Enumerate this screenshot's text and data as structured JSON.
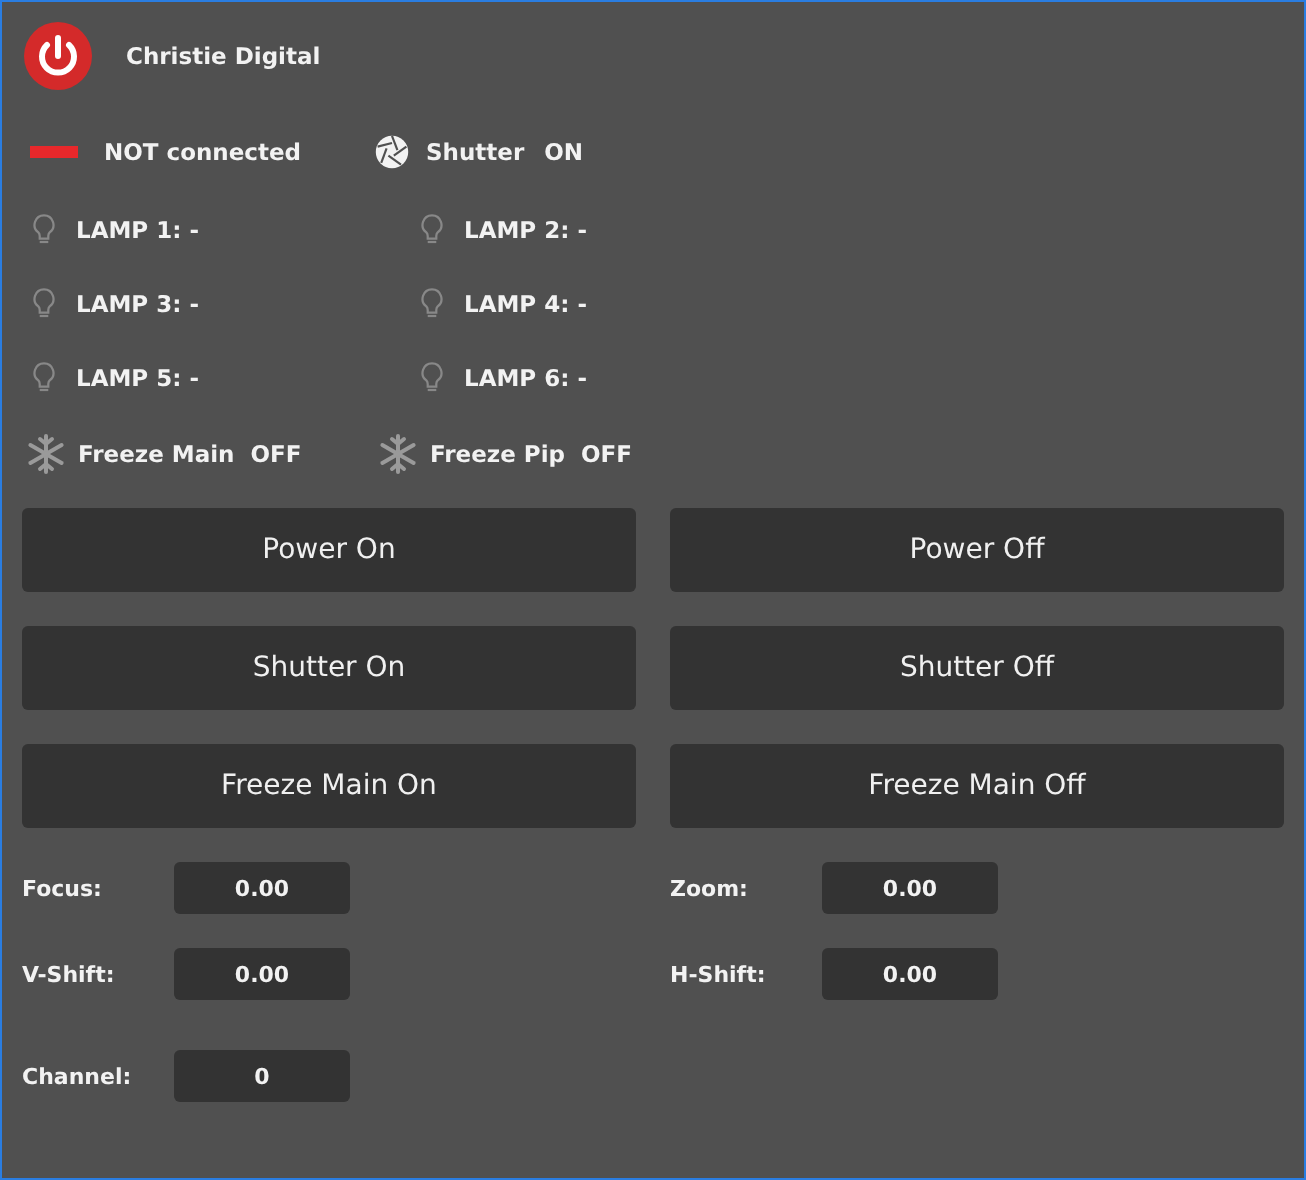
{
  "device": {
    "name": "Christie Digital",
    "powered": true
  },
  "connection": {
    "connected": false,
    "label": "NOT connected"
  },
  "shutter": {
    "label": "Shutter",
    "state": "ON",
    "on": true
  },
  "lamps": [
    {
      "label": "LAMP 1: -",
      "lit": false
    },
    {
      "label": "LAMP 2: -",
      "lit": false
    },
    {
      "label": "LAMP 3: -",
      "lit": false
    },
    {
      "label": "LAMP 4: -",
      "lit": false
    },
    {
      "label": "LAMP 5: -",
      "lit": false
    },
    {
      "label": "LAMP 6: -",
      "lit": false
    }
  ],
  "freeze": [
    {
      "label": "Freeze Main",
      "state": "OFF",
      "on": false
    },
    {
      "label": "Freeze Pip",
      "state": "OFF",
      "on": false
    }
  ],
  "buttons": [
    "Power On",
    "Power Off",
    "Shutter On",
    "Shutter Off",
    "Freeze Main On",
    "Freeze Main Off"
  ],
  "fields": [
    {
      "label": "Focus:",
      "value": "0.00"
    },
    {
      "label": "Zoom:",
      "value": "0.00"
    },
    {
      "label": "V-Shift:",
      "value": "0.00"
    },
    {
      "label": "H-Shift:",
      "value": "0.00"
    },
    {
      "label": "Channel:",
      "value": "0"
    }
  ]
}
